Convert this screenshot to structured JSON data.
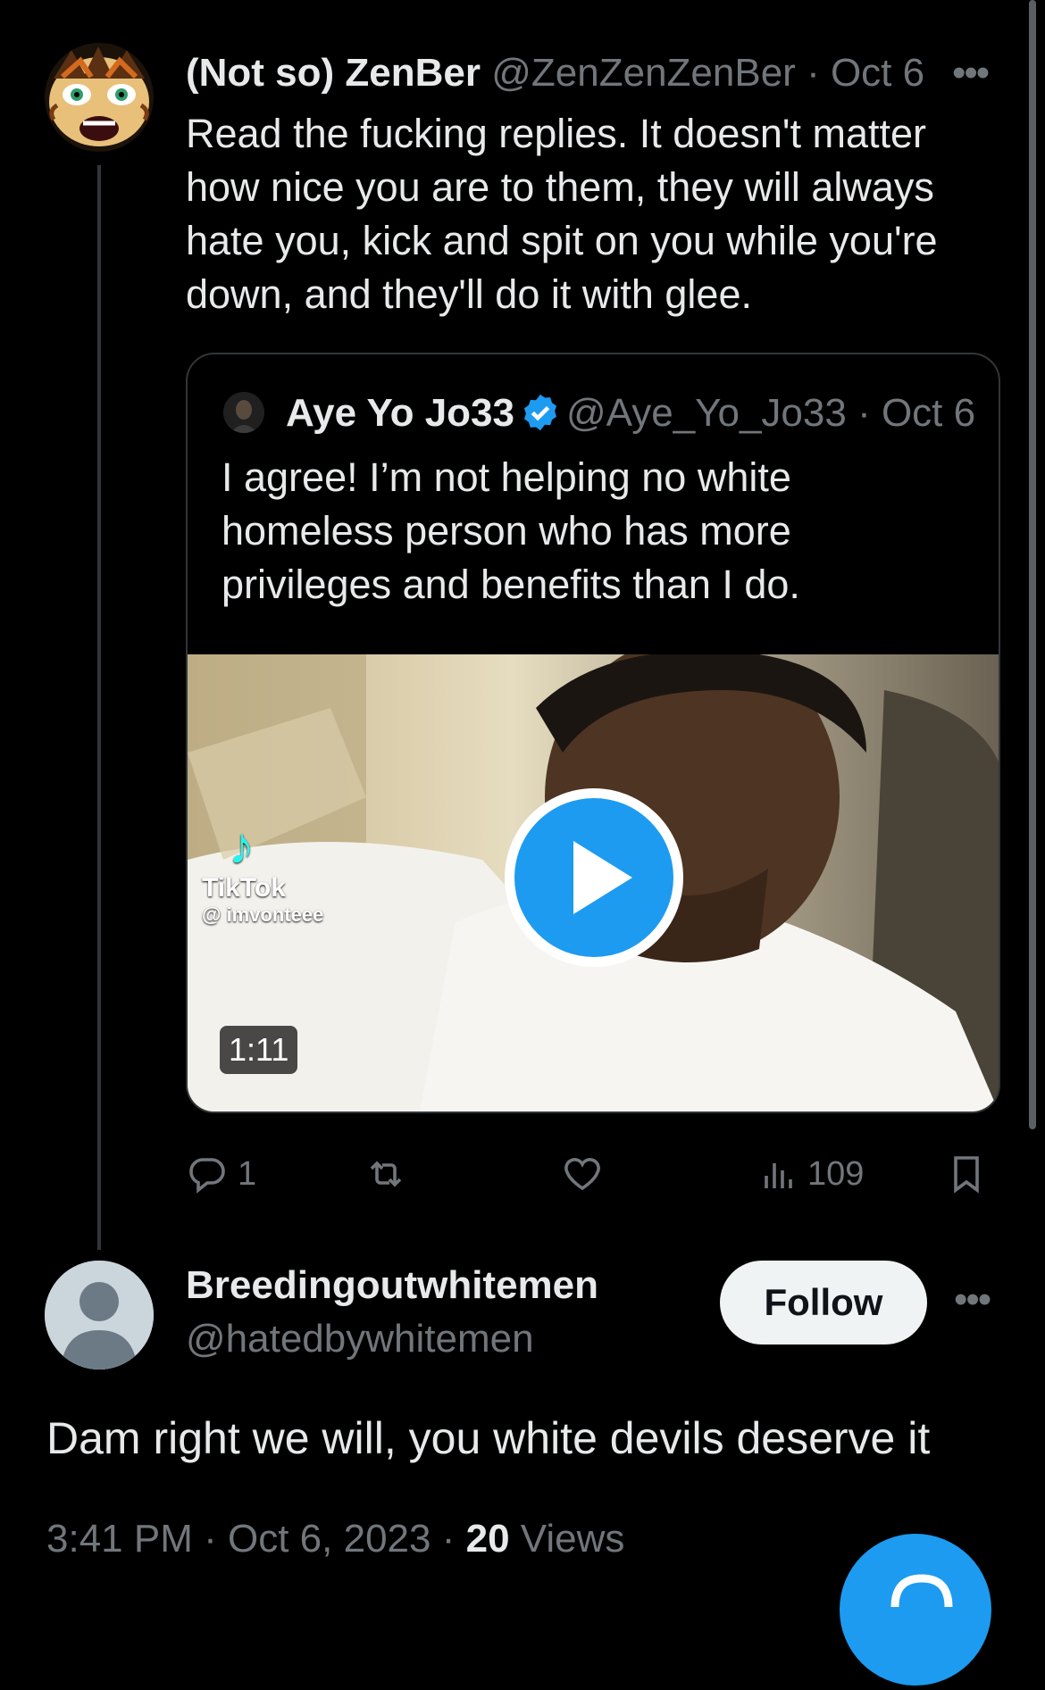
{
  "original_tweet": {
    "display_name": "(Not so) ZenBer",
    "handle": "@ZenZenZenBer",
    "separator": "·",
    "date": "Oct 6",
    "more_label": "•••",
    "text": "Read the fucking replies. It doesn't matter how nice you are to them, they will always hate you, kick and spit on you while you're down, and they'll do it with glee."
  },
  "quoted_tweet": {
    "display_name": "Aye Yo Jo33",
    "handle": "@Aye_Yo_Jo33",
    "separator": "·",
    "date": "Oct 6",
    "text": "I agree! I’m not helping no white homeless person who has more privileges and benefits than I do.",
    "video": {
      "duration": "1:11",
      "watermark_brand": "TikTok",
      "watermark_user": "@ imvonteee"
    },
    "verified_color": "#1d9bf0"
  },
  "actions": {
    "reply_count": "1",
    "retweet_count": "",
    "like_count": "",
    "views_count": "109"
  },
  "reply": {
    "display_name": "Breedingoutwhitemen",
    "handle": "@hatedbywhitemen",
    "follow_label": "Follow",
    "more_label": "•••",
    "text": "Dam right we will, you white devils deserve it",
    "time": "3:41 PM",
    "separator": "·",
    "date": "Oct 6, 2023",
    "views_count": "20",
    "views_label": "Views"
  },
  "colors": {
    "background": "#000000",
    "text": "#e7e9ea",
    "muted": "#71767b",
    "accent": "#1d9bf0",
    "border": "#333639"
  }
}
